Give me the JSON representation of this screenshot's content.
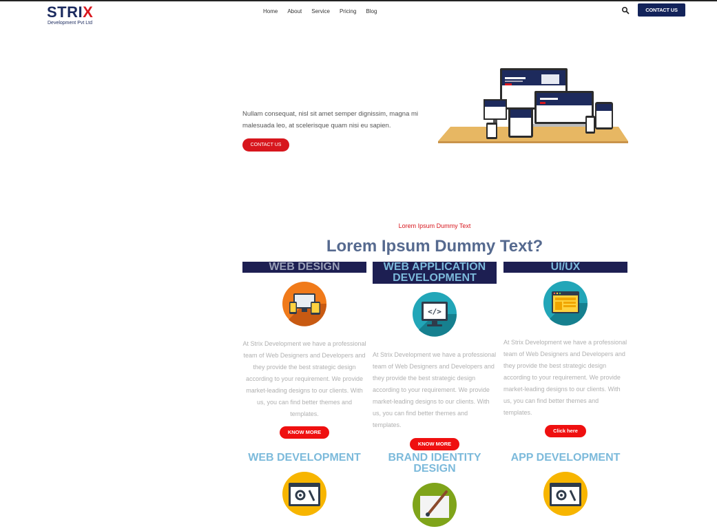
{
  "header": {
    "logo_word": "STRI",
    "logo_x": "X",
    "logo_sub": "Development Pvt Ltd",
    "nav": [
      "Home",
      "About",
      "Service",
      "Pricing",
      "Blog"
    ],
    "contact_label": "CONTACT US",
    "search_icon": "search-icon"
  },
  "hero": {
    "text": "Nullam consequat, nisl sit amet semper dignissim, magna mi malesuada leo, at scelerisque quam nisi eu sapien.",
    "button_label": "CONTACT US"
  },
  "services": {
    "kicker": "Lorem Ipsum Dummy Text",
    "title": "Lorem Ipsum Dummy Text?",
    "cards": [
      {
        "title": "WEB DESIGN",
        "icon": "devices-icon",
        "description": "At Strix Development we have a professional team of Web Designers and Developers and they provide the best strategic design according to your requirement. We provide market-leading designs to our clients. With us, you can find better themes and templates.",
        "button": "KNOW MORE"
      },
      {
        "title": "WEB APPLICATION DEVELOPMENT",
        "icon": "code-monitor-icon",
        "description": "At Strix Development we have a professional team of Web Designers and Developers and they provide the best strategic design according to your requirement. We provide market-leading designs to our clients. With us, you can find better themes and templates.",
        "button": "KNOW MORE"
      },
      {
        "title": "UI/UX",
        "icon": "layout-window-icon",
        "description": "At Strix Development we have a professional team of Web Designers and Developers and they provide the best strategic design according to your requirement. We provide market-leading designs to our clients. With us, you can find better themes and templates.",
        "button": "Click here"
      },
      {
        "title": "WEB DEVELOPMENT",
        "icon": "gear-tools-icon"
      },
      {
        "title": "BRAND IDENTITY DESIGN",
        "icon": "paintbrush-icon"
      },
      {
        "title": "APP DEVELOPMENT",
        "icon": "gear-tools-icon"
      }
    ]
  },
  "colors": {
    "brand_navy": "#13235a",
    "accent_red": "#d7161d",
    "card_title_blue": "#7cbadb"
  }
}
